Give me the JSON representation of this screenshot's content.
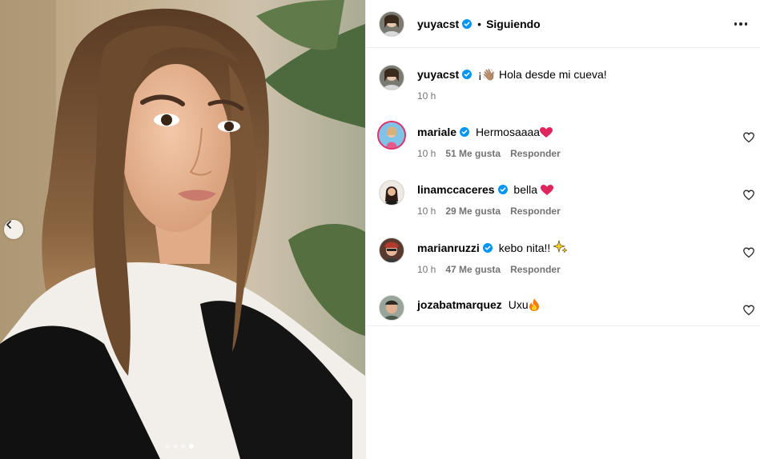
{
  "post": {
    "author": "yuyacst",
    "follow_separator": "•",
    "follow_status": "Siguiendo",
    "caption_text": "¡👋🏽 Hola desde mi cueva!",
    "caption_time": "10 h",
    "carousel": {
      "slide_count": 4,
      "active_index": 3
    }
  },
  "comments": [
    {
      "username": "mariale",
      "text": "Hermosaaaa",
      "emoji": "red-heart",
      "time": "10 h",
      "likes": "51 Me gusta",
      "reply": "Responder",
      "has_story": true
    },
    {
      "username": "linamccaceres",
      "text": "bella",
      "emoji": "red-heart",
      "time": "10 h",
      "likes": "29 Me gusta",
      "reply": "Responder",
      "has_story": false
    },
    {
      "username": "marianruzzi",
      "text": "kebo nita!!",
      "emoji": "sparkles",
      "time": "10 h",
      "likes": "47 Me gusta",
      "reply": "Responder",
      "has_story": false
    },
    {
      "username": "jozabatmarquez",
      "text": "Uxu",
      "emoji": "fire",
      "has_story": false
    }
  ],
  "icons": {
    "verified": "verified-badge-icon",
    "more": "more-horizontal-icon",
    "like": "heart-outline-icon",
    "prev": "chevron-left-icon"
  },
  "colors": {
    "verified_blue": "#0095f6",
    "secondary_text": "#737373",
    "divider": "#efefef"
  }
}
